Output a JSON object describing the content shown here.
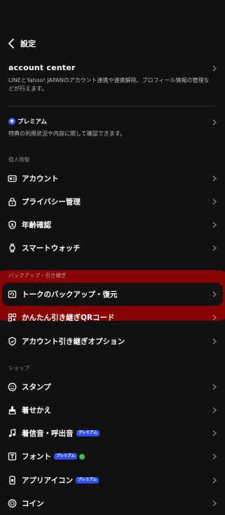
{
  "header": {
    "title": "設定"
  },
  "account_center": {
    "title": "account center",
    "description": "LINEとYahoo! JAPANのアカウント連携や連携解除、プロフィール情報の管理などが行えます。"
  },
  "premium": {
    "title": "プレミアム",
    "description": "特典の利用状況や内容に関して確認できます。"
  },
  "sections": {
    "personal": "個人情報",
    "backup": "バックアップ・引き継ぎ",
    "shop": "ショップ"
  },
  "personal_items": [
    {
      "label": "アカウント",
      "icon": "id-card-icon"
    },
    {
      "label": "プライバシー管理",
      "icon": "lock-icon"
    },
    {
      "label": "年齢確認",
      "icon": "shield-icon"
    },
    {
      "label": "スマートウォッチ",
      "icon": "watch-icon"
    }
  ],
  "backup_items": [
    {
      "label": "トークのバックアップ・復元",
      "icon": "backup-icon"
    },
    {
      "label": "かんたん引き継ぎQRコード",
      "icon": "qr-icon"
    },
    {
      "label": "アカウント引き継ぎオプション",
      "icon": "shield-check-icon"
    }
  ],
  "shop_items": [
    {
      "label": "スタンプ",
      "icon": "smile-icon"
    },
    {
      "label": "着せかえ",
      "icon": "theme-icon"
    },
    {
      "label": "着信音・呼出音",
      "icon": "music-icon",
      "badge": "プレミアム"
    },
    {
      "label": "フォント",
      "icon": "font-icon",
      "badge": "プレミアム"
    },
    {
      "label": "アプリアイコン",
      "icon": "app-icon",
      "badge": "プレミアム"
    },
    {
      "label": "コイン",
      "icon": "coin-icon"
    }
  ],
  "colors": {
    "background": "#111111",
    "highlight": "#aa0000",
    "premium_blue": "#2f4ff0",
    "new_dot": "#2fbf4a"
  }
}
